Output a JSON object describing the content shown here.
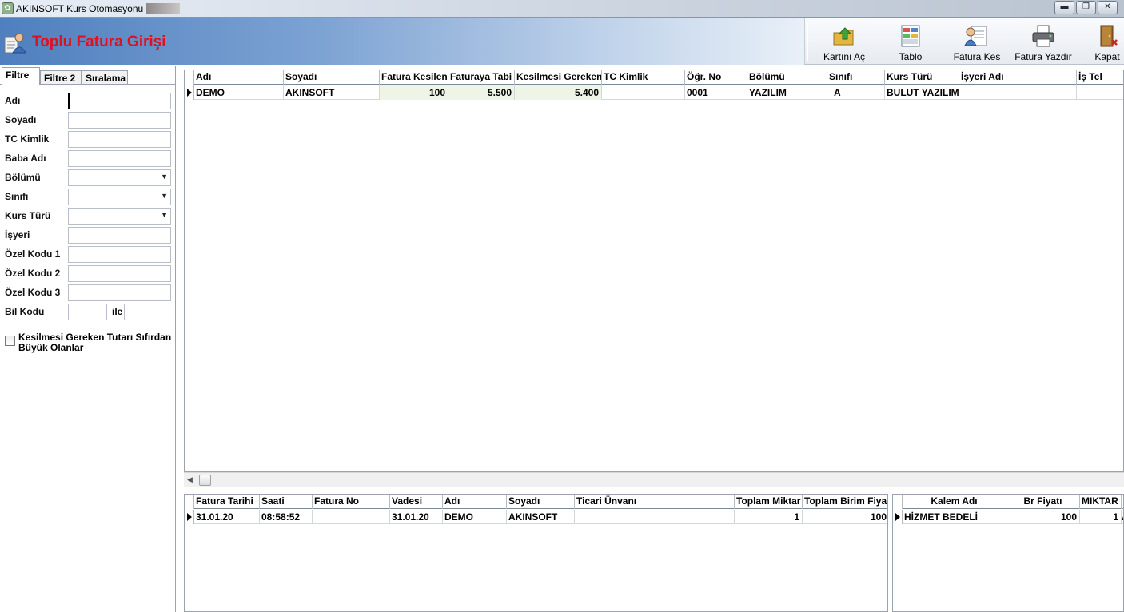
{
  "window": {
    "title": "AKINSOFT Kurs Otomasyonu s",
    "minimize_glyph": "▬",
    "maximize_glyph": "❐",
    "close_glyph": "✕"
  },
  "header": {
    "title": "Toplu Fatura Girişi",
    "title_color": "#e0101d"
  },
  "toolbar": {
    "buttons": [
      {
        "label": "Kartını Aç",
        "icon": "folder-arrow-icon"
      },
      {
        "label": "Tablo",
        "icon": "table-icon"
      },
      {
        "label": "Fatura Kes",
        "icon": "invoice-cut-icon"
      },
      {
        "label": "Fatura Yazdır",
        "icon": "printer-icon"
      },
      {
        "label": "Kapat",
        "icon": "door-exit-icon"
      }
    ]
  },
  "filter": {
    "tabs": [
      "Filtre",
      "Filtre 2",
      "Sıralama"
    ],
    "fields": [
      {
        "label": "Adı",
        "value": "",
        "type": "text"
      },
      {
        "label": "Soyadı",
        "value": "",
        "type": "text"
      },
      {
        "label": "TC Kimlik",
        "value": "",
        "type": "text"
      },
      {
        "label": "Baba Adı",
        "value": "",
        "type": "text"
      },
      {
        "label": "Bölümü",
        "value": "",
        "type": "combo"
      },
      {
        "label": "Sınıfı",
        "value": "",
        "type": "combo"
      },
      {
        "label": "Kurs Türü",
        "value": "",
        "type": "combo"
      },
      {
        "label": "İşyeri",
        "value": "",
        "type": "text"
      },
      {
        "label": "Özel Kodu 1",
        "value": "",
        "type": "text"
      },
      {
        "label": "Özel Kodu 2",
        "value": "",
        "type": "text"
      },
      {
        "label": "Özel Kodu 3",
        "value": "",
        "type": "text"
      }
    ],
    "bil_kodu_label": "Bil Kodu",
    "ile_label": "ile",
    "checkbox_label": "Kesilmesi Gereken Tutarı Sıfırdan Büyük Olanlar",
    "checkbox_checked": false
  },
  "main_grid": {
    "columns": [
      "Adı",
      "Soyadı",
      "Fatura Kesilen",
      "Faturaya Tabi",
      "Kesilmesi Gereken",
      "TC Kimlik",
      "Öğr. No",
      "Bölümü",
      "Sınıfı",
      "Kurs Türü",
      "İşyeri Adı",
      "İş Tel"
    ],
    "rows": [
      [
        "DEMO",
        "AKINSOFT",
        "100",
        "5.500",
        "5.400",
        "",
        "0001",
        "YAZILIM",
        "A",
        "BULUT YAZILIM",
        "",
        ""
      ]
    ]
  },
  "invoice_grid": {
    "columns": [
      "Fatura Tarihi",
      "Saati",
      "Fatura No",
      "Vadesi",
      "Adı",
      "Soyadı",
      "Ticari Ünvanı",
      "Toplam Miktar",
      "Toplam Birim Fiyat"
    ],
    "rows": [
      [
        "31.01.20",
        "08:58:52",
        "",
        "31.01.20",
        "DEMO",
        "AKINSOFT",
        "",
        "1",
        "100"
      ]
    ]
  },
  "item_grid": {
    "columns": [
      "Kalem Adı",
      "Br Fiyatı",
      "MIKTAR",
      "A"
    ],
    "rows": [
      [
        "HİZMET BEDELİ",
        "100",
        "1",
        "A"
      ]
    ]
  }
}
